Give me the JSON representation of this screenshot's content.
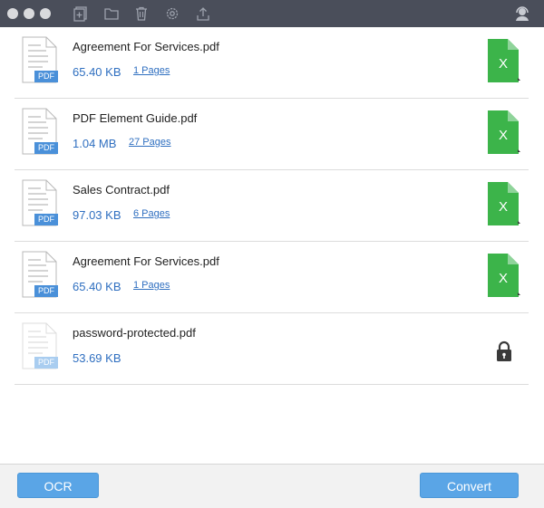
{
  "toolbar": {
    "icons": [
      "add-file-icon",
      "folder-icon",
      "trash-icon",
      "settings-icon",
      "upload-icon",
      "support-icon"
    ]
  },
  "files": [
    {
      "name": "Agreement For Services.pdf",
      "size": "65.40 KB",
      "pages": "1 Pages",
      "type_badge": "PDF",
      "output_letter": "X",
      "locked": false
    },
    {
      "name": "PDF Element Guide.pdf",
      "size": "1.04 MB",
      "pages": "27 Pages",
      "type_badge": "PDF",
      "output_letter": "X",
      "locked": false
    },
    {
      "name": "Sales Contract.pdf",
      "size": "97.03 KB",
      "pages": "6 Pages",
      "type_badge": "PDF",
      "output_letter": "X",
      "locked": false
    },
    {
      "name": "Agreement For Services.pdf",
      "size": "65.40 KB",
      "pages": "1 Pages",
      "type_badge": "PDF",
      "output_letter": "X",
      "locked": false
    },
    {
      "name": "password-protected.pdf",
      "size": "53.69 KB",
      "pages": "",
      "type_badge": "PDF",
      "output_letter": "",
      "locked": true
    }
  ],
  "footer": {
    "ocr_label": "OCR",
    "convert_label": "Convert"
  },
  "colors": {
    "titlebar": "#4a4e5a",
    "accent_blue": "#5aa5e6",
    "excel_green": "#3cb44a",
    "link_blue": "#2f6fc0"
  }
}
